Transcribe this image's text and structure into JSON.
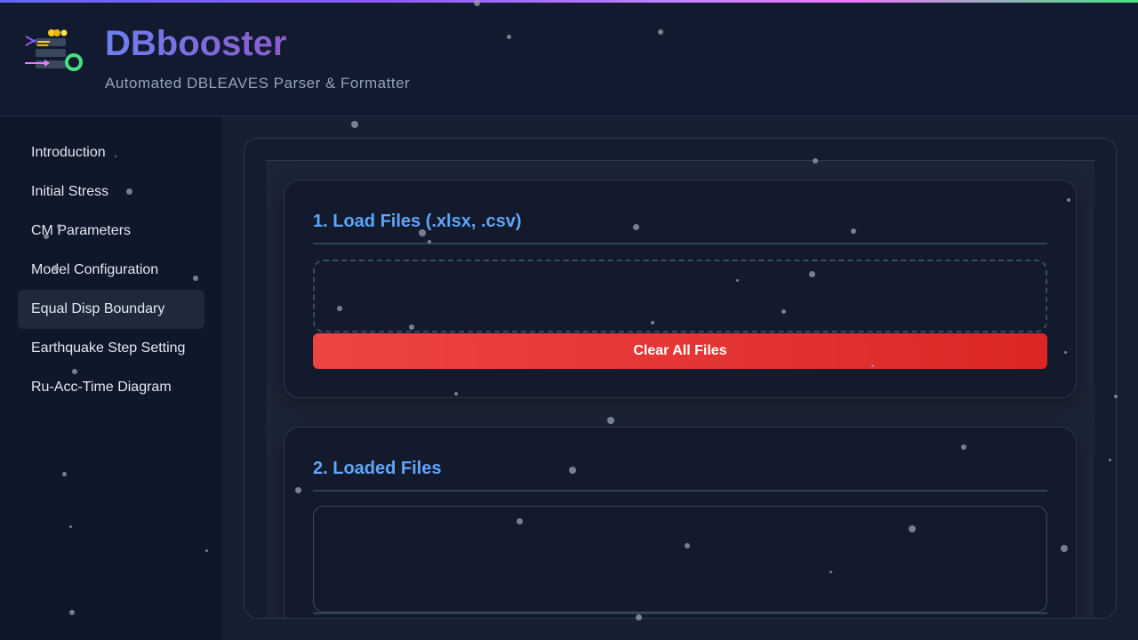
{
  "header": {
    "title": "DBbooster",
    "subtitle": "Automated DBLEAVES Parser & Formatter"
  },
  "sidebar": {
    "items": [
      {
        "label": "Introduction",
        "active": false
      },
      {
        "label": "Initial Stress",
        "active": false
      },
      {
        "label": "CM Parameters",
        "active": false
      },
      {
        "label": "Model Configuration",
        "active": false
      },
      {
        "label": "Equal Disp Boundary",
        "active": true
      },
      {
        "label": "Earthquake Step Setting",
        "active": false
      },
      {
        "label": "Ru-Acc-Time Diagram",
        "active": false
      }
    ]
  },
  "main": {
    "load_section": {
      "title": "1. Load Files (.xlsx, .csv)",
      "clear_label": "Clear All Files"
    },
    "loaded_section": {
      "title": "2. Loaded Files"
    }
  },
  "colors": {
    "accent": "#60a5fa",
    "danger": "#ef4444",
    "background": "#0f172a"
  }
}
